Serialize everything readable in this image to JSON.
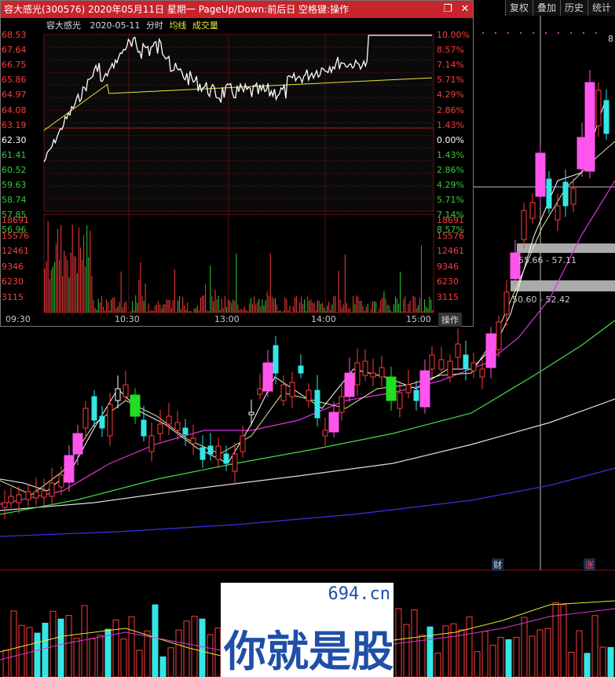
{
  "toolbar": {
    "buttons": [
      "复权",
      "叠加",
      "历史",
      "统计"
    ]
  },
  "popup": {
    "title": "容大感光(300576) 2020年05月11日 星期一 PageUp/Down:前后日 空格键:操作",
    "restore_icon": "restore-icon",
    "close_icon": "close-icon",
    "legend": {
      "name": "容大感光",
      "date": "2020-05-11",
      "mode": "分时",
      "avg": "均线",
      "vol": "成交量"
    },
    "price_labels": [
      "68.53",
      "67.64",
      "66.75",
      "65.86",
      "64.97",
      "64.08",
      "63.19",
      "62.30",
      "61.41",
      "60.52",
      "59.63",
      "58.74",
      "57.85",
      "56.96"
    ],
    "pct_labels": [
      "10.00%",
      "8.57%",
      "7.14%",
      "5.71%",
      "4.29%",
      "2.86%",
      "1.43%",
      "0.00%",
      "1.43%",
      "2.86%",
      "4.29%",
      "5.71%",
      "7.14%",
      "8.57%"
    ],
    "vol_labels": [
      "18691",
      "15576",
      "12461",
      "9346",
      "6230",
      "3115"
    ],
    "times": [
      "09:30",
      "10:30",
      "13:00",
      "14:00",
      "15:00"
    ],
    "op_button": "操作",
    "colors": {
      "up": "#ff3b3b",
      "down": "#33cc33",
      "neutral": "#ffffff",
      "price": "#ffffff",
      "avg": "#e8e83a"
    }
  },
  "main": {
    "zone1": "55.66 - 57.11",
    "zone2": "50.60 - 52.42",
    "marker_cai": "财",
    "marker_zhang": "涨",
    "top_value": "8"
  },
  "watermark": {
    "site": "694.cn",
    "slogan": "你就是股神"
  }
}
